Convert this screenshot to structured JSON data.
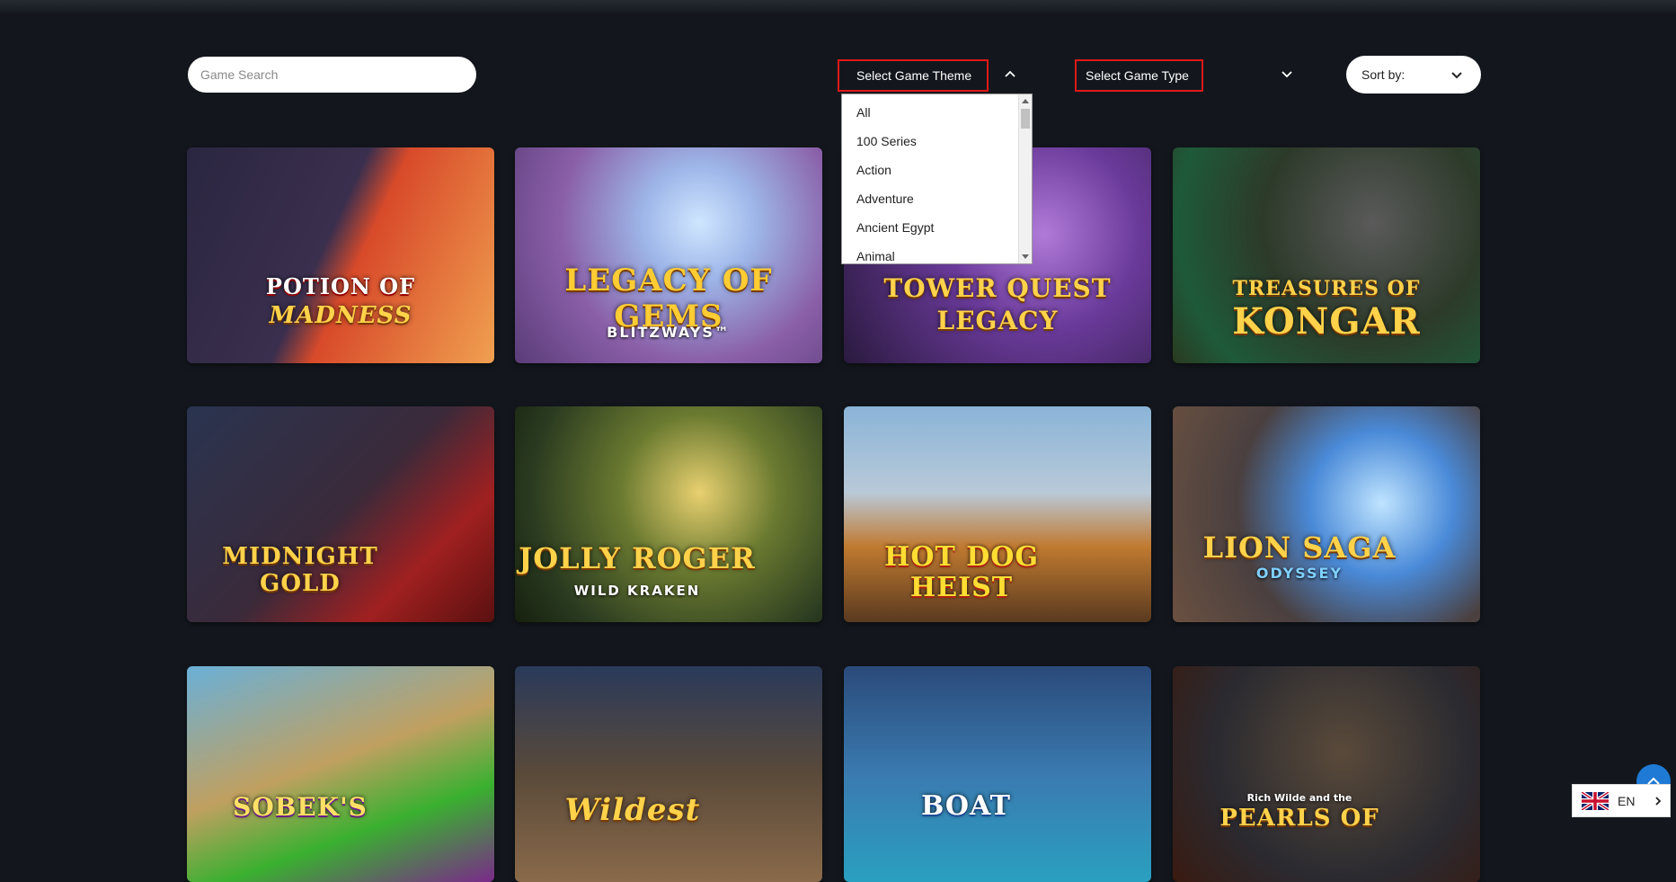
{
  "search": {
    "placeholder": "Game Search"
  },
  "filters": {
    "theme_label": "Select Game Theme",
    "type_label": "Select Game Type",
    "sort_label": "Sort by:",
    "highlight_color": "#e01818"
  },
  "theme_dropdown": {
    "options": [
      "All",
      "100 Series",
      "Action",
      "Adventure",
      "Ancient Egypt",
      "Animal"
    ]
  },
  "games": [
    {
      "title": "POTION OF",
      "subtitle": "MADNESS"
    },
    {
      "title": "LEGACY OF GEMS",
      "subtitle": "BLITZWAYS™"
    },
    {
      "title": "TOWER QUEST",
      "subtitle": "LEGACY"
    },
    {
      "title": "TREASURES OF",
      "subtitle": "KONGAR"
    },
    {
      "title": "MIDNIGHT",
      "subtitle": "GOLD"
    },
    {
      "title": "JOLLY ROGER",
      "subtitle": "WILD KRAKEN"
    },
    {
      "title": "HOT DOG",
      "subtitle": "HEIST"
    },
    {
      "title": "LION SAGA",
      "subtitle": "ODYSSEY"
    },
    {
      "title": "SOBEK'S",
      "subtitle": ""
    },
    {
      "title": "Wildest",
      "subtitle": ""
    },
    {
      "title": "BOAT",
      "subtitle": ""
    },
    {
      "title": "Rich Wilde and the",
      "subtitle": "PEARLS OF"
    }
  ],
  "language": {
    "code": "EN",
    "flag_icon": "uk-flag-icon"
  },
  "accent_color": "#1f7ad6"
}
